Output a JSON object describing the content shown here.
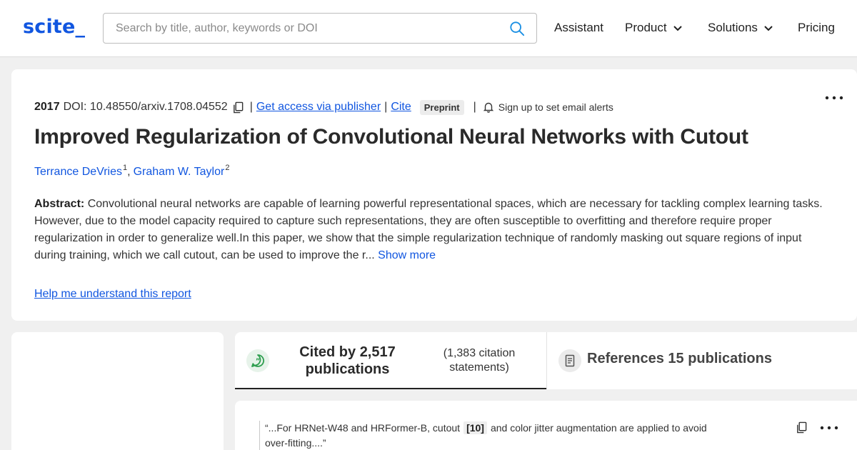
{
  "header": {
    "logo": "scite_",
    "search_placeholder": "Search by title, author, keywords or DOI",
    "nav": [
      {
        "label": "Assistant"
      },
      {
        "label": "Product"
      },
      {
        "label": "Solutions"
      },
      {
        "label": "Pricing"
      }
    ]
  },
  "paper": {
    "year": "2017",
    "doi": "DOI: 10.48550/arxiv.1708.04552",
    "sep": "|",
    "access_link": "Get access via publisher",
    "cite_link": "Cite",
    "badge": "Preprint",
    "alerts": "Sign up to set email alerts",
    "title": "Improved Regularization of Convolutional Neural Networks with Cutout",
    "authors": [
      {
        "name": "Terrance DeVries",
        "sup": "1"
      },
      {
        "name": "Graham W. Taylor",
        "sup": "2"
      }
    ],
    "author_sep": ",",
    "abstract_label": "Abstract:",
    "abstract_text": "Convolutional neural networks are capable of learning powerful representational spaces, which are necessary for tackling complex learning tasks. However, due to the model capacity required to capture such representations, they are often susceptible to overfitting and therefore require proper regularization in order to generalize well.In this paper, we show that the simple regularization technique of randomly masking out square regions of input during training, which we call cutout, can be used to improve the r...",
    "show_more": "Show more",
    "help_link": "Help me understand this report"
  },
  "tabs": {
    "cited_by": "Cited by 2,517 publications",
    "cited_statements": "(1,383 citation statements)",
    "references": "References 15 publications"
  },
  "citation": {
    "before": "“...For HRNet-W48 and HRFormer-B, cutout",
    "ref": "[10]",
    "after": "and color jitter augmentation are applied to avoid over-fitting....”"
  },
  "icons": {
    "search": "search-icon",
    "chevron": "chevron-down-icon",
    "copy": "copy-icon",
    "bell": "bell-icon",
    "more": "more-icon",
    "cite": "speech-bubble-quote-icon",
    "document": "document-icon"
  },
  "colors": {
    "brand": "#1156e0",
    "cite_icon_green": "#2e9e4f",
    "background": "#f0f0f0"
  }
}
